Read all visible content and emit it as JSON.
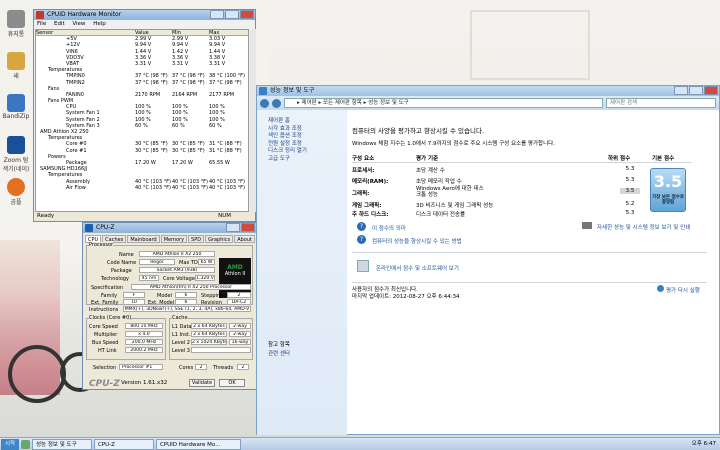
{
  "desktop": {
    "icons": [
      {
        "label": "휴지통",
        "color": "#8c8c8c"
      },
      {
        "label": "새",
        "color": "#d8a640"
      },
      {
        "label": "BandiZip",
        "color": "#3b76c4"
      },
      {
        "label": "Zoom\n탐색기(네이)",
        "color": "#1b4f9a"
      },
      {
        "label": "곰플",
        "color": "#e37021"
      }
    ]
  },
  "hwmonitor": {
    "title": "CPUID Hardware Monitor",
    "menu": [
      "File",
      "Edit",
      "View",
      "Help"
    ],
    "columns": [
      "Sensor",
      "Value",
      "Min",
      "Max"
    ],
    "rows": [
      [
        "+5V",
        "2.99 V",
        "2.99 V",
        "3.03 V"
      ],
      [
        "+12V",
        "9.94 V",
        "9.94 V",
        "9.94 V"
      ],
      [
        "VIN6",
        "1.44 V",
        "1.42 V",
        "1.44 V"
      ],
      [
        "VDD3V",
        "3.36 V",
        "3.36 V",
        "3.38 V"
      ],
      [
        "VBAT",
        "3.31 V",
        "3.31 V",
        "3.31 V"
      ],
      [
        "Temperatures",
        "",
        "",
        ""
      ],
      [
        "TMPIN0",
        "37 °C (98 °F)",
        "37 °C (98 °F)",
        "38 °C (100 °F)"
      ],
      [
        "TMPIN2",
        "37 °C (98 °F)",
        "37 °C (98 °F)",
        "37 °C (98 °F)"
      ],
      [
        "Fans",
        "",
        "",
        ""
      ],
      [
        "FANIN0",
        "2170 RPM",
        "2164 RPM",
        "2177 RPM"
      ],
      [
        "Fans PWM",
        "",
        "",
        ""
      ],
      [
        "CPU",
        "100 %",
        "100 %",
        "100 %"
      ],
      [
        "System Fan 1",
        "100 %",
        "100 %",
        "100 %"
      ],
      [
        "System Fan 2",
        "100 %",
        "100 %",
        "100 %"
      ],
      [
        "System Fan 3",
        "60 %",
        "60 %",
        "60 %"
      ],
      [
        "AMD Athlon X2 250",
        "",
        "",
        ""
      ],
      [
        "Temperatures",
        "",
        "",
        ""
      ],
      [
        "Core #0",
        "30 °C (85 °F)",
        "30 °C (85 °F)",
        "31 °C (88 °F)"
      ],
      [
        "Core #1",
        "30 °C (85 °F)",
        "30 °C (85 °F)",
        "31 °C (88 °F)"
      ],
      [
        "Powers",
        "",
        "",
        ""
      ],
      [
        "Package",
        "17.20 W",
        "17.20 W",
        "65.55 W"
      ],
      [
        "SAMSUNG HD166JJ",
        "",
        "",
        ""
      ],
      [
        "Temperatures",
        "",
        "",
        ""
      ],
      [
        "Assembly",
        "40 °C (103 °F)",
        "40 °C (103 °F)",
        "40 °C (103 °F)"
      ],
      [
        "Air Flow",
        "40 °C (103 °F)",
        "40 °C (103 °F)",
        "40 °C (103 °F)"
      ]
    ],
    "status": "Ready",
    "num": "NUM"
  },
  "cpuz": {
    "title": "CPU-Z",
    "tabs": [
      "CPU",
      "Caches",
      "Mainboard",
      "Memory",
      "SPD",
      "Graphics",
      "About"
    ],
    "processor_label": "Processor",
    "name_label": "Name",
    "name": "AMD Athlon II X2 250",
    "codename_label": "Code Name",
    "codename": "Regor",
    "maxtdp_label": "Max TDP",
    "maxtdp": "65 W",
    "package_label": "Package",
    "package": "Socket AM3 (938)",
    "tech_label": "Technology",
    "tech": "45 nm",
    "corevolt_label": "Core Voltage",
    "corevolt": "1.320 V",
    "spec_label": "Specification",
    "spec": "AMD Athlon(tm) II X2 250 Processor",
    "family_label": "Family",
    "family": "F",
    "model_label": "Model",
    "model": "6",
    "stepping_label": "Stepping",
    "stepping": "2",
    "extfamily_label": "Ext. Family",
    "extfamily": "10",
    "extmodel_label": "Ext. Model",
    "extmodel": "6",
    "revision_label": "Revision",
    "revision": "DA-C2",
    "instr_label": "Instructions",
    "instr": "MMX(+), 3DNow!(+), SSE (1, 2, 3, 4A), x86-64, AMD-V",
    "clocks_label": "Clocks (Core #0)",
    "corespeed_label": "Core Speed",
    "corespeed": "800.10 MHz",
    "multi_label": "Multiplier",
    "multi": "x 4.0",
    "bus_label": "Bus Speed",
    "bus": "200.0 MHz",
    "ht_label": "HT Link",
    "ht": "2000.2 MHz",
    "cache_label": "Cache",
    "l1d_label": "L1 Data",
    "l1d": "2 x 64 KBytes",
    "l1d_way": "2-way",
    "l1i_label": "L1 Inst.",
    "l1i": "2 x 64 KBytes",
    "l1i_way": "2-way",
    "l2_label": "Level 2",
    "l2": "2 x 1024 KBytes",
    "l2_way": "16-way",
    "l3_label": "Level 3",
    "l3": "",
    "selection_label": "Selection",
    "selection": "Processor #1",
    "cores_label": "Cores",
    "cores": "2",
    "threads_label": "Threads",
    "threads": "2",
    "logo": "CPU-Z",
    "version": "Version 1.61.x32",
    "validate": "Validate",
    "ok": "OK",
    "amd_logo_top": "AMD",
    "amd_logo_bottom": "Athlon II"
  },
  "sysinfo": {
    "title": "성능 정보 및 도구",
    "breadcrumb": "▸ 제어판 ▸ 모든 제어판 항목 ▸ 성능 정보 및 도구",
    "search_placeholder": "제어판 검색",
    "left_links": [
      "제어판 홈",
      "",
      "시각 효과 조정",
      "색인 옵션 조정",
      "전원 설정 조정",
      "디스크 정리 열기",
      "고급 도구"
    ],
    "left_bottom_title": "참고 항목",
    "left_bottom_link": "관련 센터",
    "heading": "컴퓨터의 사양을 평가하고 향상시킬 수 있습니다.",
    "subheading": "Windows 체험 지수는 1.0에서 7.9까지의 점수로 주요 시스템 구성 요소를 평가합니다.",
    "col_component": "구성 요소",
    "col_target": "평가 기준",
    "col_subscore": "하위 점수",
    "col_base": "기본 점수",
    "rows": [
      {
        "comp": "프로세서:",
        "desc": "초당 계산 수",
        "score": "5.3"
      },
      {
        "comp": "메모리(RAM):",
        "desc": "초당 메모리 작업 수",
        "score": "5.3"
      },
      {
        "comp": "그래픽:",
        "desc": "Windows Aero에 대한 데스크톱 성능",
        "score": "3.5"
      },
      {
        "comp": "게임 그래픽:",
        "desc": "3D 비즈니스 및 게임 그래픽 성능",
        "score": "5.2"
      },
      {
        "comp": "주 하드 디스크:",
        "desc": "디스크 데이터 전송률",
        "score": "5.3"
      }
    ],
    "base_score": "3.5",
    "base_caption": "가장 낮은 점수로 결정됨",
    "link1": "이 점수의 의미",
    "link2": "컴퓨터의 성능을 향상시킬 수 있는 방법",
    "link3": "자세한 성능 및 시스템 정보 보기 및 인쇄",
    "online_link": "온라인에서 점수 및 소프트웨어 보기",
    "status1": "사용자의 점수가 최신입니다.",
    "status2": "마지막 업데이트: 2012-08-27 오후 6:44:34",
    "rerun": "평가 다시 실행"
  },
  "taskbar": {
    "start": "시작",
    "tasks": [
      "성능 정보 및 도구",
      "CPU-Z",
      "CPUID Hardware Mo..."
    ],
    "clock": "오후 6:47"
  }
}
